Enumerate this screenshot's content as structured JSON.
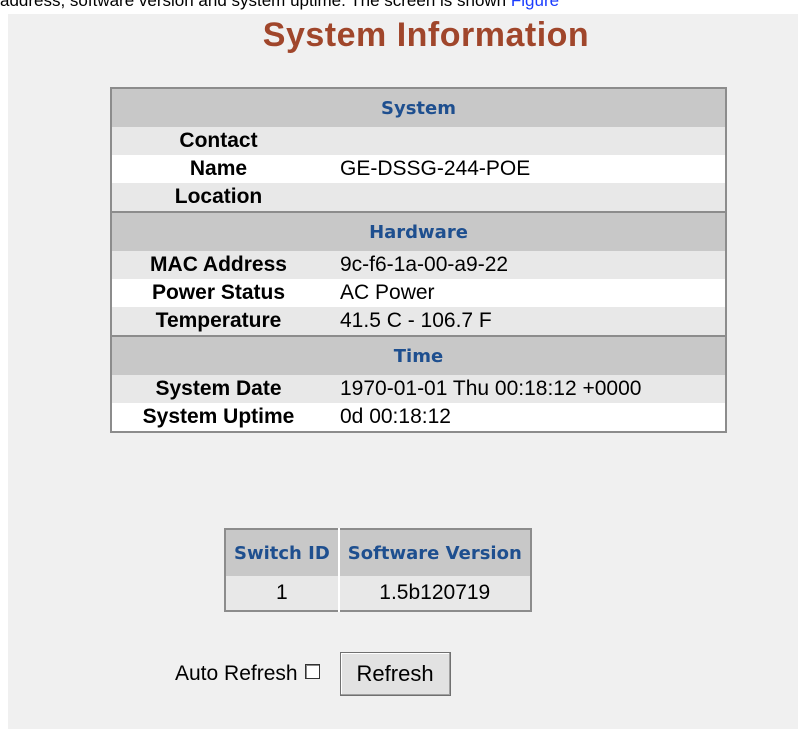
{
  "intro": {
    "text": "address, software version and system uptime. The screen is shown ",
    "link": "Figure"
  },
  "title": "System Information",
  "system": {
    "header": "System",
    "rows": [
      {
        "label": "Contact",
        "value": ""
      },
      {
        "label": "Name",
        "value": "GE-DSSG-244-POE"
      },
      {
        "label": "Location",
        "value": ""
      }
    ]
  },
  "hardware": {
    "header": "Hardware",
    "rows": [
      {
        "label": "MAC Address",
        "value": "9c-f6-1a-00-a9-22"
      },
      {
        "label": "Power Status",
        "value": "AC Power"
      },
      {
        "label": "Temperature",
        "value": "41.5 C - 106.7 F"
      }
    ]
  },
  "time": {
    "header": "Time",
    "rows": [
      {
        "label": "System Date",
        "value": "1970-01-01 Thu 00:18:12 +0000"
      },
      {
        "label": "System Uptime",
        "value": "0d 00:18:12"
      }
    ]
  },
  "software": {
    "headers": [
      "Switch ID",
      "Software Version"
    ],
    "rows": [
      {
        "switch_id": "1",
        "version": "1.5b120719"
      }
    ]
  },
  "controls": {
    "auto_refresh_label": "Auto Refresh",
    "auto_refresh_checked": false,
    "refresh_button": "Refresh"
  }
}
